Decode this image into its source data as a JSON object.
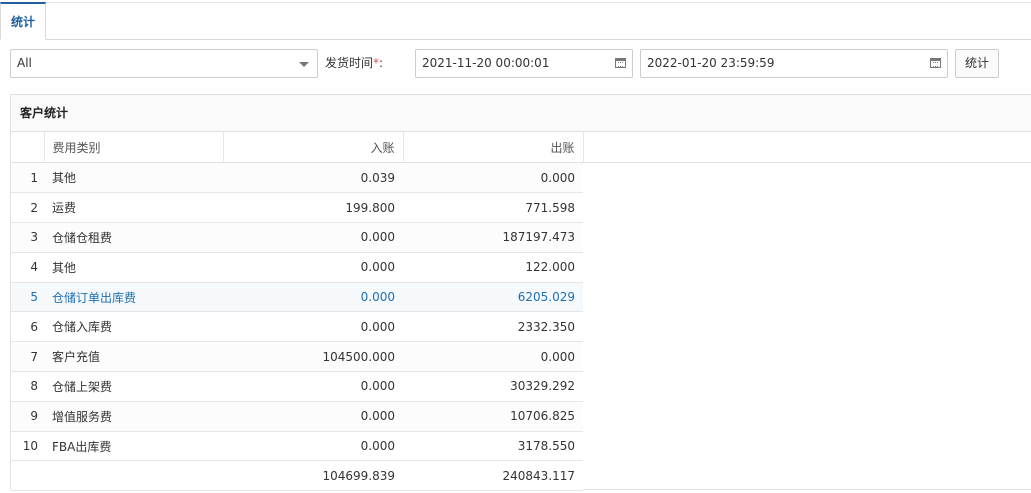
{
  "tabs": [
    {
      "label": "统计"
    }
  ],
  "filters": {
    "customer_select": "All",
    "ship_time_label": "发货时间",
    "required_mark": "*",
    "colon": ":",
    "start_date": "2021-11-20 00:00:01",
    "end_date": "2022-01-20 23:59:59",
    "submit_label": "统计"
  },
  "panel": {
    "title": "客户统计",
    "columns": [
      "费用类别",
      "入账",
      "出账"
    ],
    "rows": [
      {
        "idx": "1",
        "name": "其他",
        "in": "0.039",
        "out": "0.000"
      },
      {
        "idx": "2",
        "name": "运费",
        "in": "199.800",
        "out": "771.598"
      },
      {
        "idx": "3",
        "name": "仓储仓租费",
        "in": "0.000",
        "out": "187197.473"
      },
      {
        "idx": "4",
        "name": "其他",
        "in": "0.000",
        "out": "122.000"
      },
      {
        "idx": "5",
        "name": "仓储订单出库费",
        "in": "0.000",
        "out": "6205.029"
      },
      {
        "idx": "6",
        "name": "仓储入库费",
        "in": "0.000",
        "out": "2332.350"
      },
      {
        "idx": "7",
        "name": "客户充值",
        "in": "104500.000",
        "out": "0.000"
      },
      {
        "idx": "8",
        "name": "仓储上架费",
        "in": "0.000",
        "out": "30329.292"
      },
      {
        "idx": "9",
        "name": "增值服务费",
        "in": "0.000",
        "out": "10706.825"
      },
      {
        "idx": "10",
        "name": "FBA出库费",
        "in": "0.000",
        "out": "3178.550"
      }
    ],
    "totals": {
      "in": "104699.839",
      "out": "240843.117"
    }
  }
}
